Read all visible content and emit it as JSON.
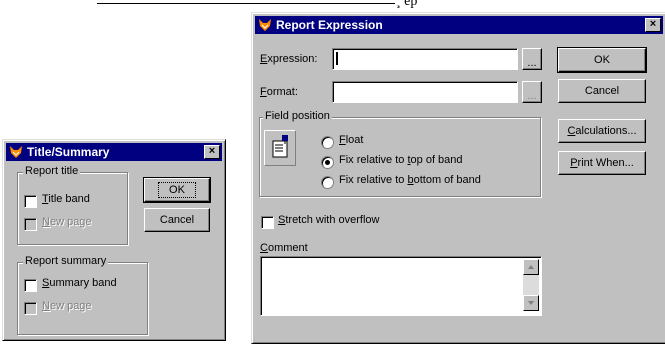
{
  "background_fragment": {
    "text": "¸ ep"
  },
  "title_summary_dialog": {
    "title": "Title/Summary",
    "close_glyph": "×",
    "report_title_group": {
      "label": "Report title",
      "title_band": {
        "pre": "",
        "key": "T",
        "rest": "itle band",
        "checked": false
      },
      "new_page": {
        "pre": "",
        "key": "N",
        "rest": "ew page",
        "enabled": false
      }
    },
    "report_summary_group": {
      "label": "Report summary",
      "summary_band": {
        "pre": "",
        "key": "S",
        "rest": "ummary band",
        "checked": false
      },
      "new_page": {
        "pre": "",
        "key": "N",
        "rest": "ew page",
        "enabled": false
      }
    },
    "ok_label": "OK",
    "cancel_label": "Cancel"
  },
  "report_expression_dialog": {
    "title": "Report Expression",
    "close_glyph": "×",
    "expression": {
      "key": "E",
      "rest": "xpression:",
      "value": ""
    },
    "format": {
      "key": "F",
      "rest": "ormat:",
      "value": ""
    },
    "browse_label": "...",
    "field_position": {
      "label": "Field position",
      "options": [
        {
          "pre": "",
          "key": "F",
          "rest": "loat",
          "selected": false
        },
        {
          "pre": "Fix relative to ",
          "key": "t",
          "rest": "op of band",
          "selected": true
        },
        {
          "pre": "Fix relative to ",
          "key": "b",
          "rest": "ottom of band",
          "selected": false
        }
      ]
    },
    "stretch": {
      "key": "S",
      "rest": "tretch with overflow",
      "checked": false
    },
    "comment": {
      "key": "C",
      "rest": "omment",
      "value": ""
    },
    "ok_label": "OK",
    "cancel_label": "Cancel",
    "calculations": {
      "key": "C",
      "rest": "alculations..."
    },
    "print_when": {
      "key": "P",
      "rest": "rint When..."
    }
  }
}
